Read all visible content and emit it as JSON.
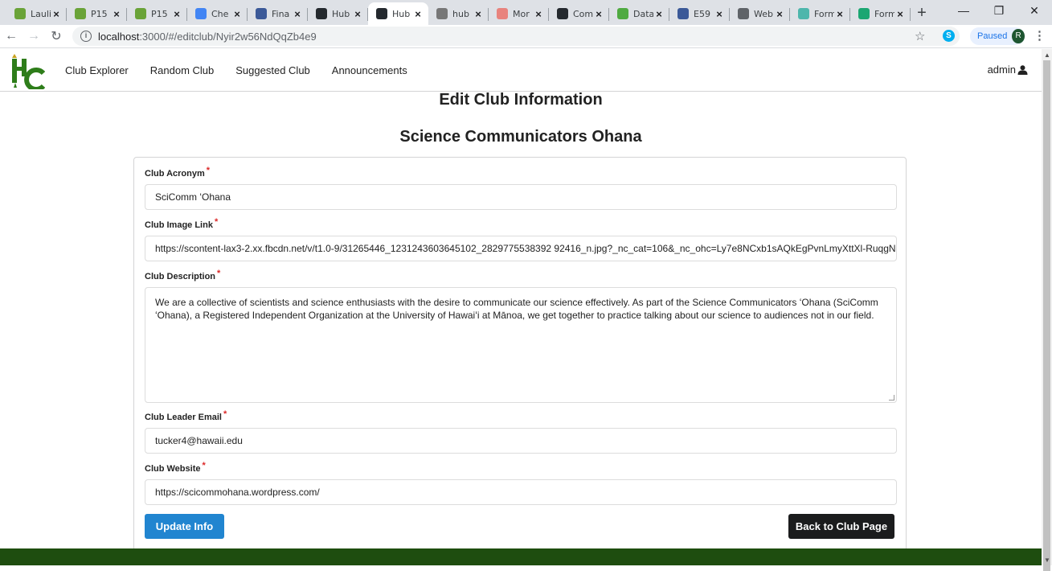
{
  "browser": {
    "tabs": [
      {
        "title": "Lauli",
        "color": "#6aa338",
        "icon": "leaf-icon"
      },
      {
        "title": "P15",
        "color": "#6aa338",
        "icon": "leaf-icon"
      },
      {
        "title": "P15",
        "color": "#6aa338",
        "icon": "leaf-icon"
      },
      {
        "title": "Che",
        "color": "#4285f4",
        "icon": "docs-icon"
      },
      {
        "title": "Fina",
        "color": "#3b5998",
        "icon": "page-icon"
      },
      {
        "title": "Hub",
        "color": "#24292e",
        "icon": "hub-icon"
      },
      {
        "title": "Hub",
        "color": "#24292e",
        "icon": "hub-icon"
      },
      {
        "title": "hub",
        "color": "#777777",
        "icon": "feather-icon"
      },
      {
        "title": "Mor",
        "color": "#e8837d",
        "icon": "page-icon"
      },
      {
        "title": "Com",
        "color": "#24292e",
        "icon": "github-icon"
      },
      {
        "title": "Data",
        "color": "#4faa41",
        "icon": "mongo-icon"
      },
      {
        "title": "E59",
        "color": "#3b5998",
        "icon": "page-icon"
      },
      {
        "title": "Web",
        "color": "#5f6368",
        "icon": "grid-icon"
      },
      {
        "title": "Form",
        "color": "#4db6ac",
        "icon": "form-icon"
      },
      {
        "title": "Form",
        "color": "#1ba672",
        "icon": "sheet-icon"
      }
    ],
    "active_tab_index": 6,
    "new_tab": "+",
    "url_host": "localhost",
    "url_path": ":3000/#/editclub/Nyir2w56NdQqZb4e9",
    "profile_status": "Paused",
    "profile_initial": "R",
    "skype_letter": "S"
  },
  "nav": {
    "items": [
      "Club Explorer",
      "Random Club",
      "Suggested Club",
      "Announcements"
    ],
    "user_label": "admin"
  },
  "page": {
    "title": "Edit Club Information",
    "club_name": "Science Communicators Ohana"
  },
  "form": {
    "acronym": {
      "label": "Club Acronym",
      "value": "SciComm ʻOhana"
    },
    "image_link": {
      "label": "Club Image Link",
      "value": "https://scontent-lax3-2.xx.fbcdn.net/v/t1.0-9/31265446_1231243603645102_2829775538392 92416_n.jpg?_nc_cat=106&_nc_ohc=Ly7e8NCxb1sAQkEgPvnLmyXttXl-RuqgN"
    },
    "description": {
      "label": "Club Description",
      "value": "We are a collective of scientists and science enthusiasts with the desire to communicate our science effectively. As part of the Science Communicators ʻOhana (SciComm ʻOhana), a Registered Independent Organization at the University of Hawaiʻi at Mānoa, we get together to practice talking about our science to audiences not in our field."
    },
    "leader_email": {
      "label": "Club Leader Email",
      "value": "tucker4@hawaii.edu"
    },
    "website": {
      "label": "Club Website",
      "value": "https://scicommohana.wordpress.com/"
    },
    "required_mark": "*",
    "update_button": "Update Info",
    "back_button": "Back to Club Page"
  },
  "colors": {
    "primary": "#2185d0",
    "dark": "#1b1c1d",
    "brand_green": "#1e4d0f",
    "required": "#db2828"
  }
}
